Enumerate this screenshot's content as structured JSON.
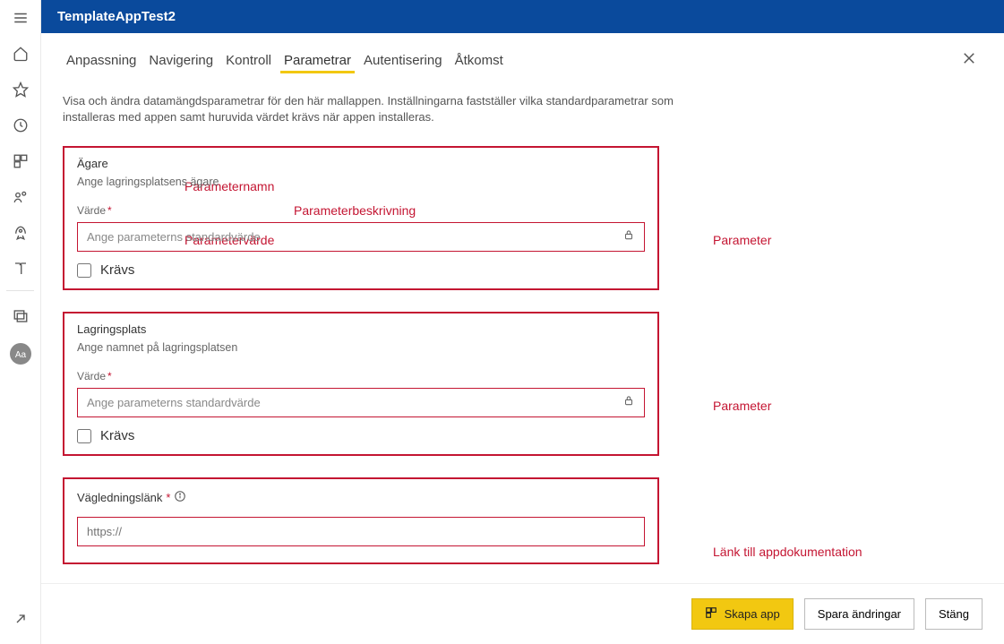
{
  "app": {
    "title": "TemplateAppTest2"
  },
  "tabs": [
    {
      "label": "Anpassning"
    },
    {
      "label": "Navigering"
    },
    {
      "label": "Kontroll"
    },
    {
      "label": "Parametrar"
    },
    {
      "label": "Autentisering"
    },
    {
      "label": "Åtkomst"
    }
  ],
  "active_tab_index": 3,
  "description": "Visa och ändra datamängdsparametrar för den här mallappen. Inställningarna fastställer vilka standardparametrar som installeras med appen samt huruvida värdet krävs när appen installeras.",
  "annotations": {
    "param_name": "Parameternamn",
    "param_desc": "Parameterbeskrivning",
    "param_value": "Parametervärde",
    "parameter": "Parameter",
    "doc_link": "Länk till appdokumentation"
  },
  "field_labels": {
    "value": "Värde",
    "required": "Krävs",
    "guidance_link": "Vägledningslänk"
  },
  "placeholders": {
    "param_value": "Ange parameterns standardvärde",
    "guidance": "https://"
  },
  "parameters": [
    {
      "title": "Ägare",
      "description": "Ange lagringsplatsens ägare",
      "required_checked": false
    },
    {
      "title": "Lagringsplats",
      "description": "Ange namnet på lagringsplatsen",
      "required_checked": false
    }
  ],
  "footer": {
    "create_app": "Skapa app",
    "save_changes": "Spara ändringar",
    "close": "Stäng"
  }
}
